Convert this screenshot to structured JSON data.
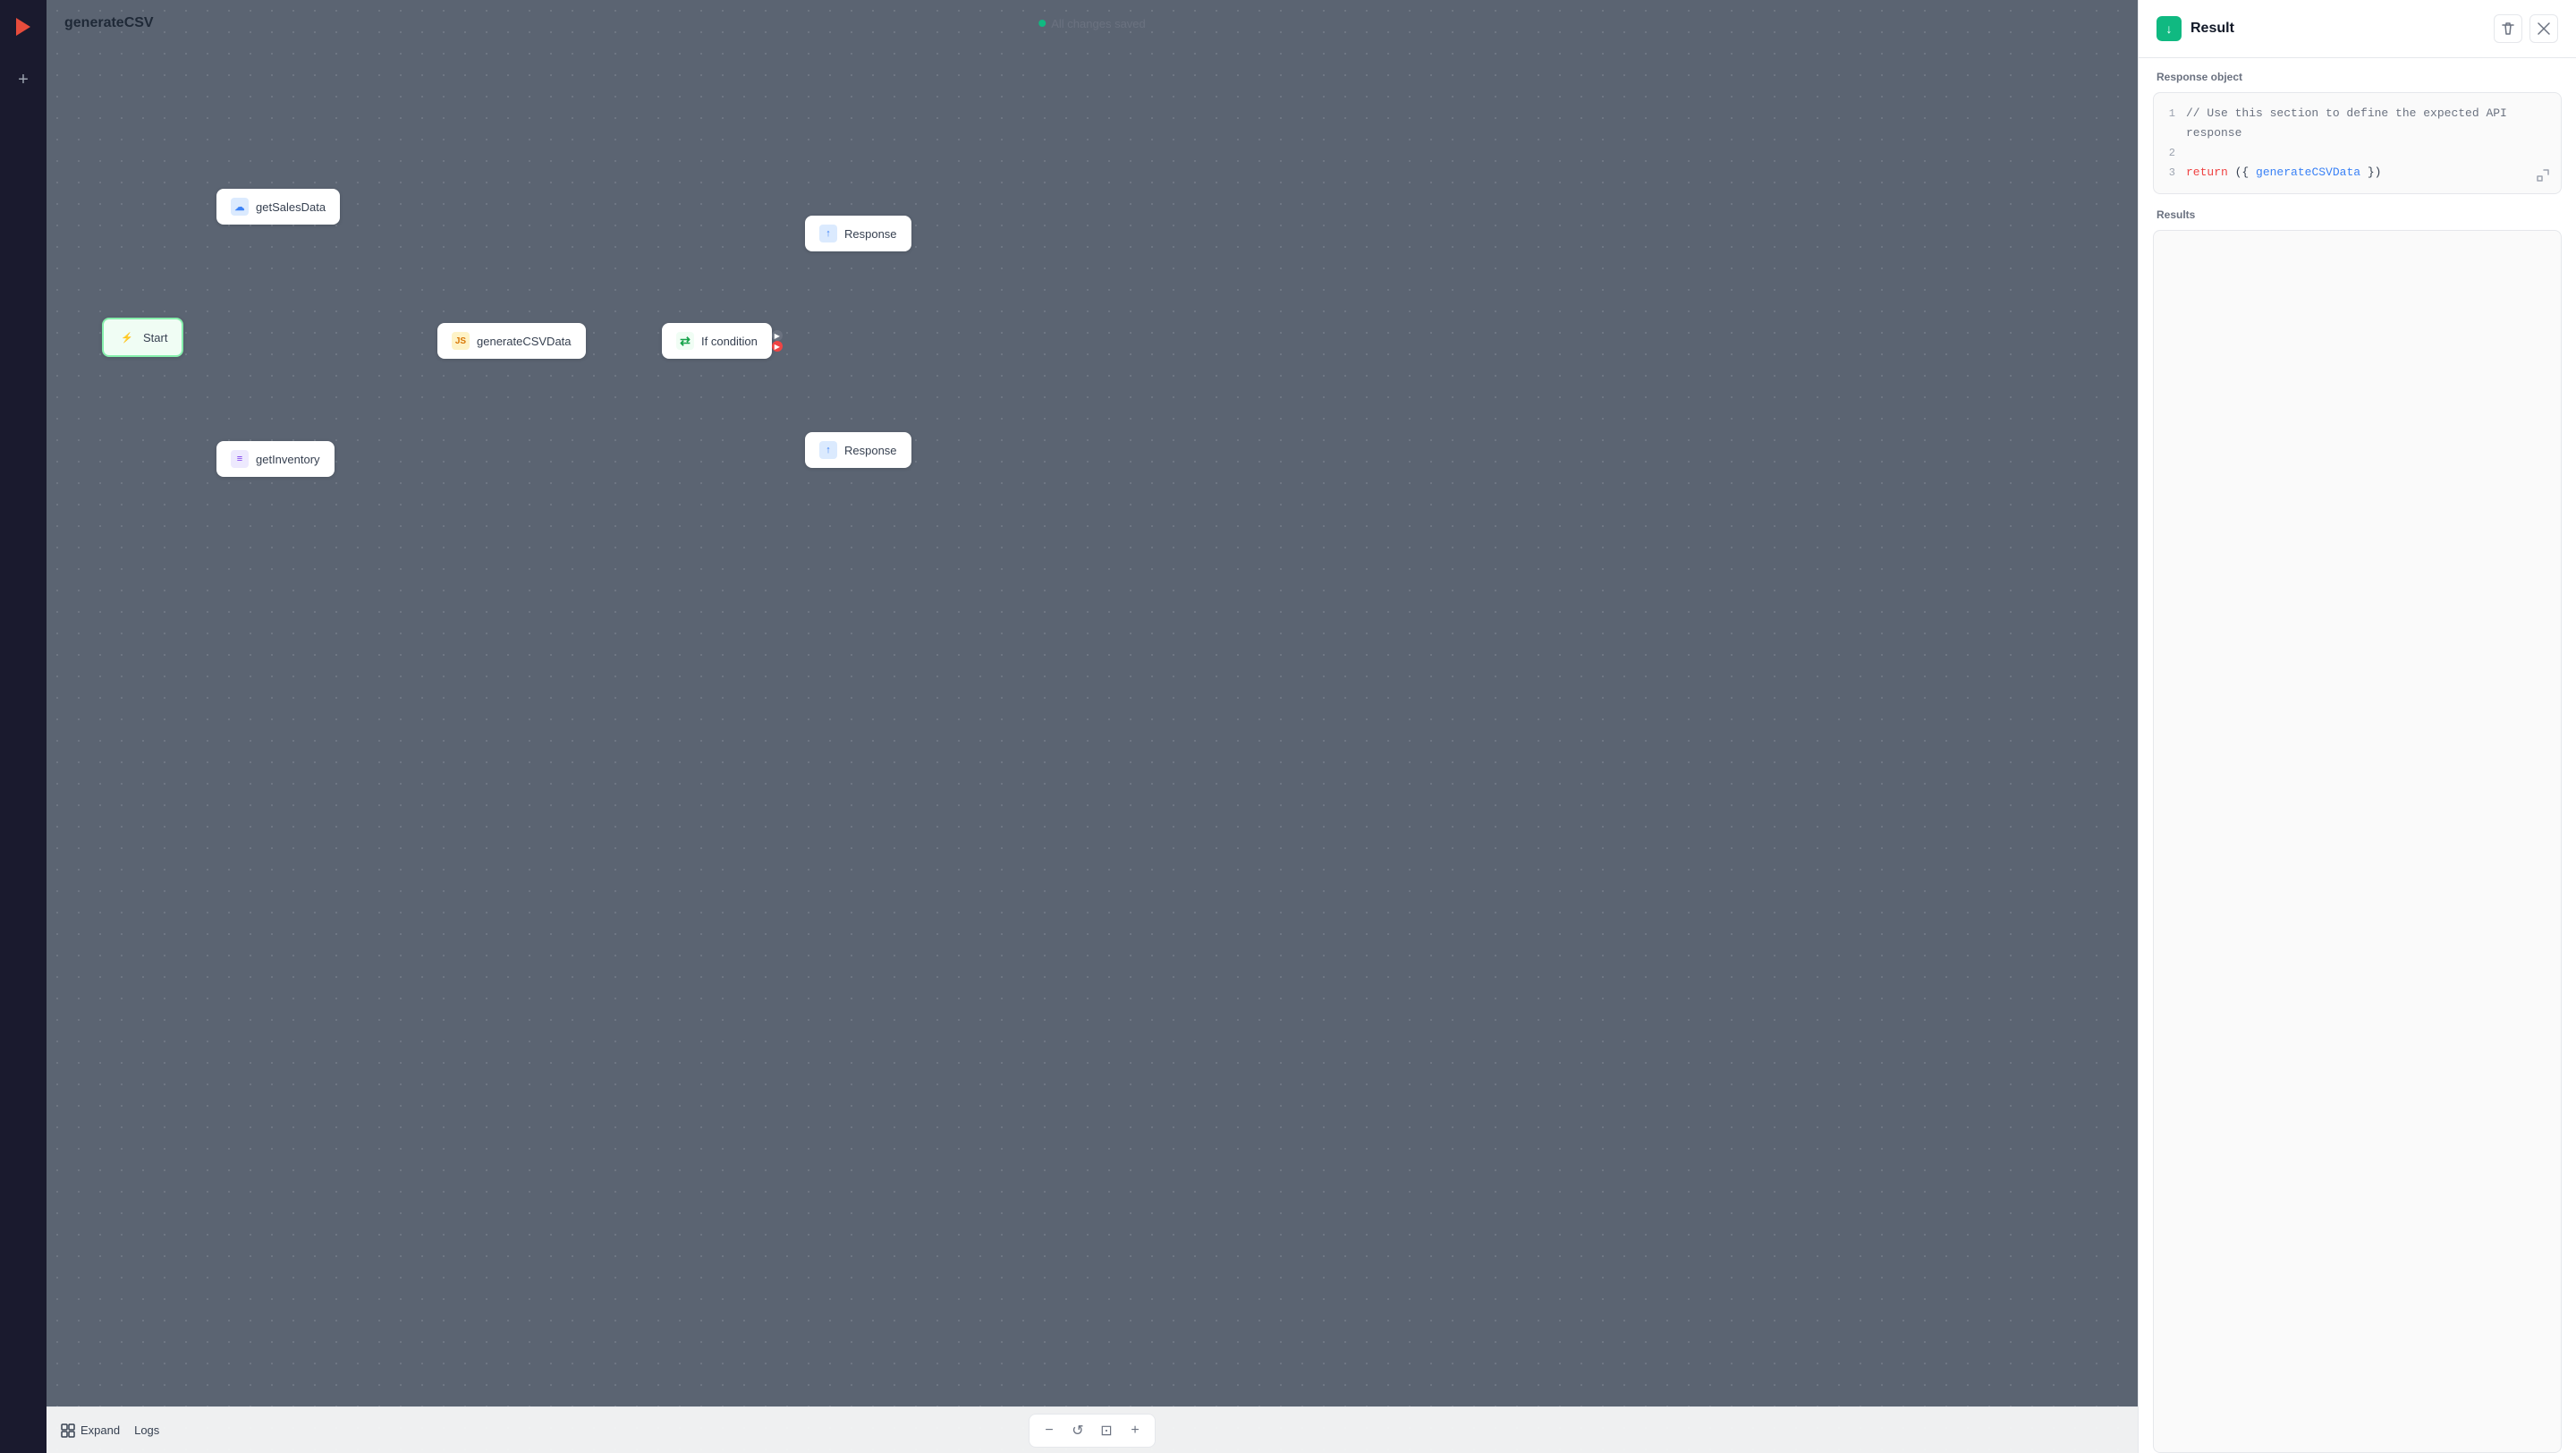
{
  "app": {
    "title": "generateCSV",
    "status": "All changes saved"
  },
  "sidebar": {
    "logo_symbol": "▶",
    "nav_icon": "+"
  },
  "canvas": {
    "nodes": [
      {
        "id": "start",
        "label": "Start",
        "icon_type": "start",
        "icon_symbol": "⚡"
      },
      {
        "id": "getSalesData",
        "label": "getSalesData",
        "icon_type": "cloud",
        "icon_symbol": "☁"
      },
      {
        "id": "getInventory",
        "label": "getInventory",
        "icon_type": "db",
        "icon_symbol": "≡"
      },
      {
        "id": "generateCSVData",
        "label": "generateCSVData",
        "icon_type": "js",
        "icon_symbol": "JS"
      },
      {
        "id": "ifCondition",
        "label": "If condition",
        "icon_type": "if",
        "icon_symbol": "⇄"
      },
      {
        "id": "response1",
        "label": "Response",
        "icon_type": "response",
        "icon_symbol": "↑"
      },
      {
        "id": "response2",
        "label": "Response",
        "icon_type": "response",
        "icon_symbol": "↑"
      }
    ]
  },
  "bottom_toolbar": {
    "expand_label": "Expand",
    "logs_label": "Logs",
    "zoom_in_label": "+",
    "zoom_out_label": "−",
    "reset_label": "↺",
    "fit_label": "⊡"
  },
  "right_panel": {
    "title": "Result",
    "icon_symbol": "↓",
    "response_object_label": "Response object",
    "results_label": "Results",
    "code_lines": [
      {
        "number": "1",
        "content": "// Use this section to define the expected API response",
        "type": "comment"
      },
      {
        "number": "2",
        "content": "",
        "type": "empty"
      },
      {
        "number": "3",
        "content_parts": [
          {
            "text": "return ",
            "type": "keyword"
          },
          {
            "text": "({",
            "type": "plain"
          },
          {
            "text": "generateCSVData",
            "type": "function"
          },
          {
            "text": "})",
            "type": "plain"
          }
        ],
        "type": "mixed"
      }
    ],
    "delete_btn_label": "🗑",
    "close_btn_label": "✕"
  }
}
